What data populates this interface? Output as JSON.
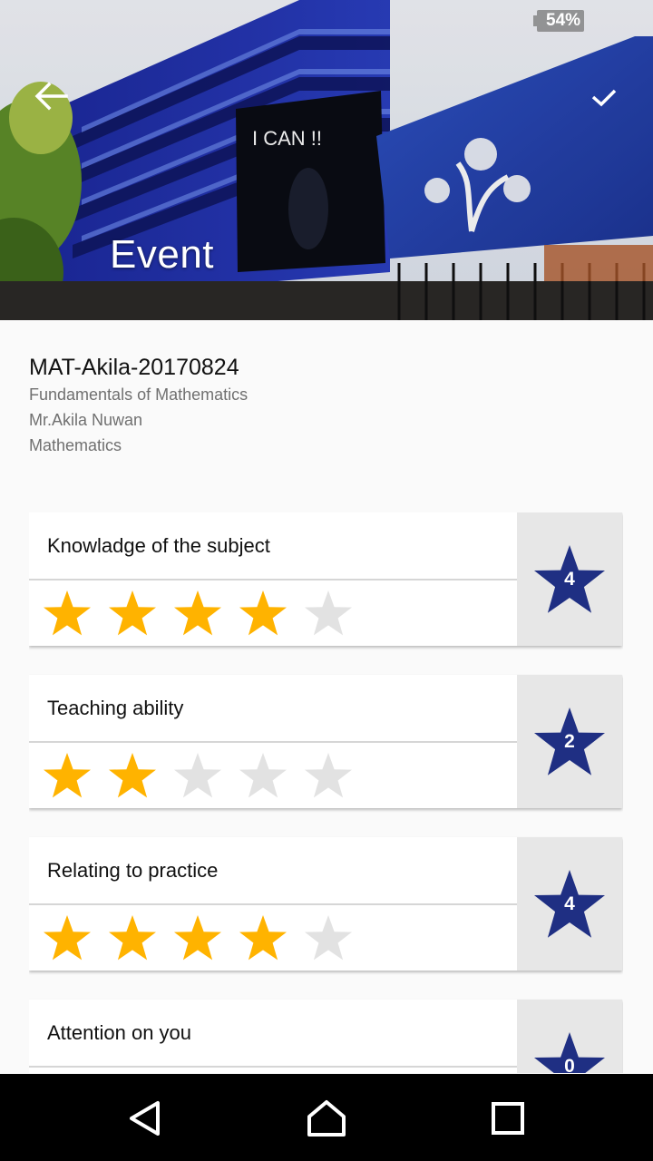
{
  "header": {
    "title": "Event",
    "back_icon": "arrow-back-icon",
    "confirm_icon": "check-icon"
  },
  "status_bar": {
    "battery": "54%"
  },
  "event": {
    "code": "MAT-Akila-20170824",
    "course": "Fundamentals of Mathematics",
    "lecturer": "Mr.Akila Nuwan",
    "subject": "Mathematics"
  },
  "ratings": [
    {
      "label": "Knowladge of the subject",
      "score": "4",
      "stars": 4
    },
    {
      "label": "Teaching ability",
      "score": "2",
      "stars": 2
    },
    {
      "label": "Relating to practice",
      "score": "4",
      "stars": 4
    },
    {
      "label": "Attention on you",
      "score": "0",
      "stars": 0
    }
  ],
  "colors": {
    "star_filled": "#FFB300",
    "star_empty": "#E2E2E2",
    "score_star": "#1F2F83",
    "score_panel": "#E7E7E7"
  },
  "navigation": {
    "back_icon": "nav-back-icon",
    "home_icon": "nav-home-icon",
    "recents_icon": "nav-recents-icon"
  }
}
